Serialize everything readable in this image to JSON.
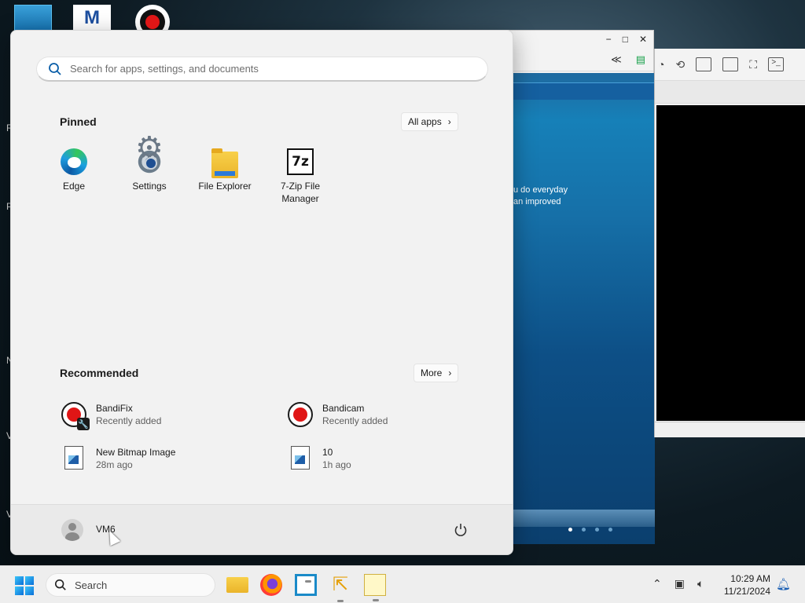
{
  "desktop": {
    "icon_logo_letter": "M",
    "side_letters": [
      "R",
      "P",
      "N",
      "V",
      "V"
    ]
  },
  "background_window": {
    "promo_line_1": "u do everyday",
    "promo_line_2": "an improved",
    "minimize": "−",
    "maximize": "□",
    "close": "✕"
  },
  "start_menu": {
    "search": {
      "placeholder": "Search for apps, settings, and documents",
      "value": ""
    },
    "pinned": {
      "title": "Pinned",
      "all_apps_label": "All apps",
      "items": [
        {
          "label": "Edge",
          "icon": "edge-icon"
        },
        {
          "label": "Settings",
          "icon": "settings-icon"
        },
        {
          "label": "File Explorer",
          "icon": "folder-icon"
        },
        {
          "label": "7-Zip File Manager",
          "icon": "7zip-icon"
        }
      ]
    },
    "recommended": {
      "title": "Recommended",
      "more_label": "More",
      "items": [
        {
          "name": "BandiFix",
          "sub": "Recently added",
          "icon": "bandifix-icon"
        },
        {
          "name": "Bandicam",
          "sub": "Recently added",
          "icon": "bandicam-icon"
        },
        {
          "name": "New Bitmap Image",
          "sub": "28m ago",
          "icon": "image-file-icon"
        },
        {
          "name": "10",
          "sub": "1h ago",
          "icon": "image-file-icon"
        }
      ]
    },
    "user": {
      "name": "VM6"
    }
  },
  "taskbar": {
    "search_label": "Search",
    "time": "10:29 AM",
    "date": "11/21/2024"
  },
  "colors": {
    "accent": "#0a6fd8",
    "start_bg": "#f2f2f2",
    "taskbar_bg": "#eeeeee"
  }
}
